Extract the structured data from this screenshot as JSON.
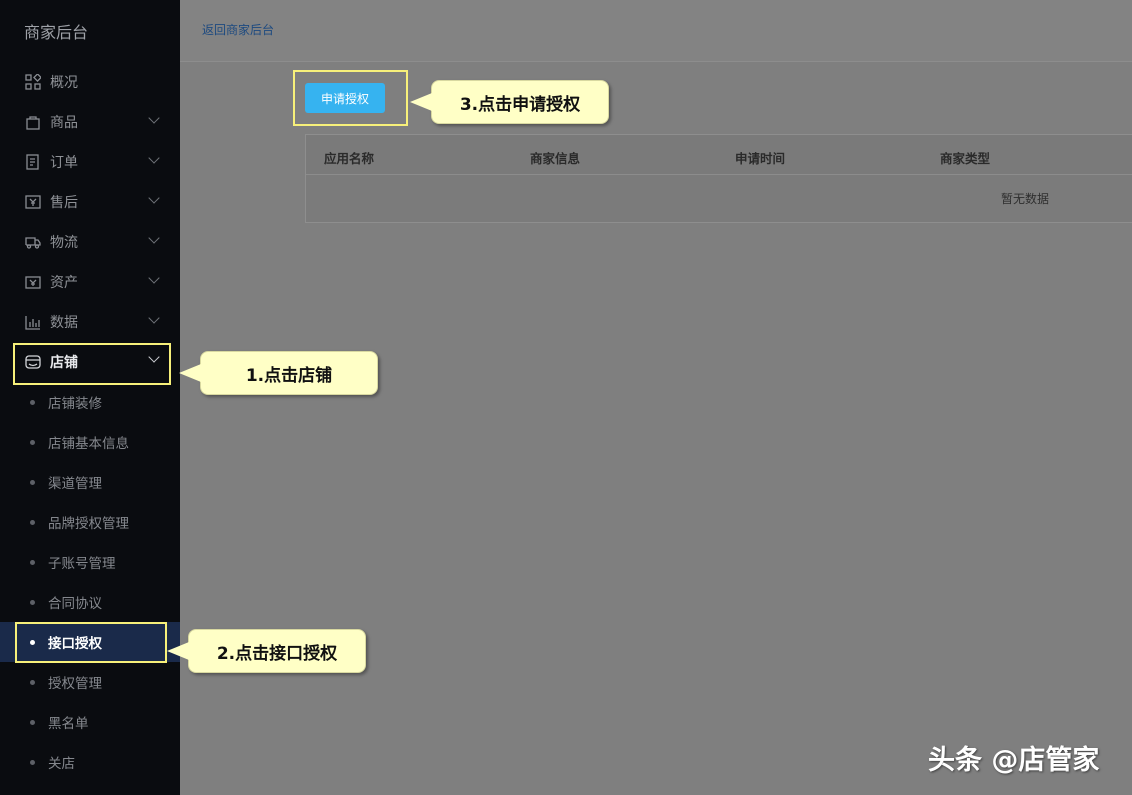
{
  "sidebar": {
    "brand": "商家后台",
    "nav": [
      {
        "label": "概况",
        "icon": "dashboard-icon"
      },
      {
        "label": "商品",
        "icon": "bag-icon"
      },
      {
        "label": "订单",
        "icon": "order-icon"
      },
      {
        "label": "售后",
        "icon": "aftersale-icon"
      },
      {
        "label": "物流",
        "icon": "truck-icon"
      },
      {
        "label": "资产",
        "icon": "wallet-icon"
      },
      {
        "label": "数据",
        "icon": "chart-icon"
      },
      {
        "label": "店铺",
        "icon": "shop-icon"
      }
    ],
    "shop_sub": [
      "店铺装修",
      "店铺基本信息",
      "渠道管理",
      "品牌授权管理",
      "子账号管理",
      "合同协议",
      "接口授权",
      "授权管理",
      "黑名单",
      "关店"
    ]
  },
  "header": {
    "back_link": "返回商家后台"
  },
  "main": {
    "apply_button": "申请授权",
    "table": {
      "headers": [
        "应用名称",
        "商家信息",
        "申请时间",
        "商家类型"
      ],
      "empty_text": "暂无数据"
    }
  },
  "callouts": {
    "step1": "1.点击店铺",
    "step2": "2.点击接口授权",
    "step3": "3.点击申请授权"
  },
  "watermark": "头条 @店管家",
  "colors": {
    "highlight": "#f7f07a",
    "callout_bg": "#ffffc6",
    "button": "#36b3f0",
    "selected_item": "#1a2a4a"
  }
}
